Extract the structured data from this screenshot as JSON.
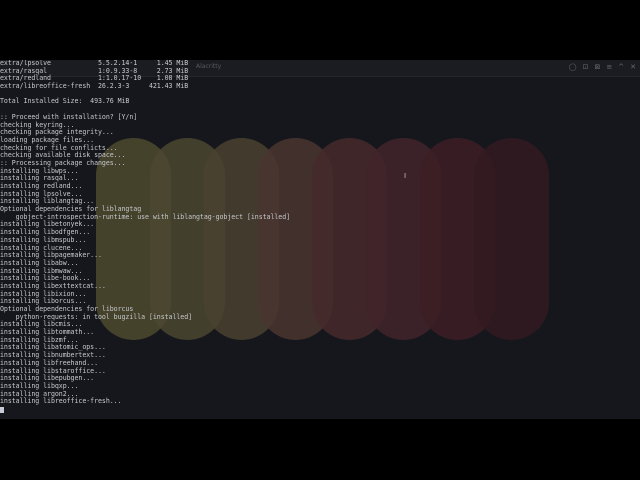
{
  "window": {
    "title": "Alacritty",
    "controls": [
      "◯",
      "⊡",
      "⊠",
      "≡",
      "^",
      "✕"
    ]
  },
  "terminal": {
    "lines": [
      "extra/lpsolve            5.5.2.14-1     1.45 MiB",
      "extra/rasqal             1:0.9.33-8     2.73 MiB",
      "extra/redland            1:1.0.17-10    1.08 MiB",
      "extra/libreoffice-fresh  26.2.3-3     421.43 MiB",
      "",
      "Total Installed Size:  493.76 MiB",
      "",
      ":: Proceed with installation? [Y/n]",
      "checking keyring...",
      "checking package integrity...",
      "loading package files...",
      "checking for file conflicts...",
      "checking available disk space...",
      ":: Processing package changes...",
      "installing libwps...",
      "installing rasqal...",
      "installing redland...",
      "installing lpsolve...",
      "installing liblangtag...",
      "Optional dependencies for liblangtag",
      "    gobject-introspection-runtime: use with liblangtag-gobject [installed]",
      "installing libetonyek...",
      "installing libodfgen...",
      "installing libmspub...",
      "installing clucene...",
      "installing libpagemaker...",
      "installing libabw...",
      "installing libmwaw...",
      "installing libe-book...",
      "installing libexttextcat...",
      "installing libixion...",
      "installing liborcus...",
      "Optional dependencies for liborcus",
      "    python-requests: in tool bugzilla [installed]",
      "installing libcmis...",
      "installing libtommath...",
      "installing libzmf...",
      "installing libatomic_ops...",
      "installing libnumbertext...",
      "installing libfreehand...",
      "installing libstaroffice...",
      "installing libepubgen...",
      "installing libqxp...",
      "installing argon2...",
      "installing libreoffice-fresh..."
    ]
  },
  "colors": {
    "background": "#15171c",
    "text": "#c6c9ce",
    "pills": [
      "#4d4a2e",
      "#4b4630",
      "#4a4230",
      "#4a3530",
      "#45292c",
      "#42232a",
      "#3d1f25",
      "#311a20"
    ]
  }
}
